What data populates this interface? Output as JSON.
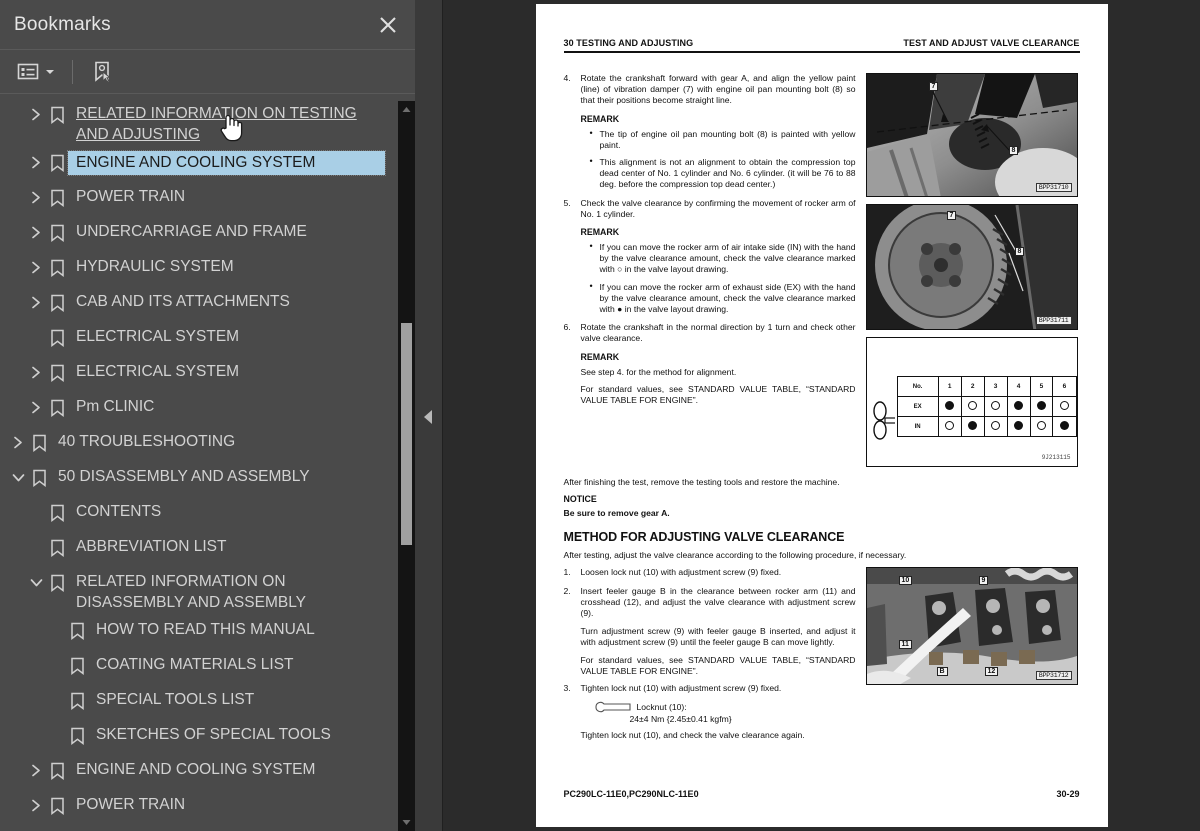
{
  "panel": {
    "title": "Bookmarks",
    "close_icon": "close-icon",
    "toolbar": {
      "options_icon": "list-options-icon",
      "dropdown_icon": "chevron-down-icon",
      "new_bookmark_icon": "new-bookmark-icon"
    },
    "items": [
      {
        "label": "RELATED INFORMATION ON TESTING AND ADJUSTING",
        "level": 1,
        "twisty": "collapsed",
        "state": "hovered"
      },
      {
        "label": "ENGINE AND COOLING SYSTEM",
        "level": 1,
        "twisty": "collapsed",
        "state": "selected"
      },
      {
        "label": "POWER TRAIN",
        "level": 1,
        "twisty": "collapsed",
        "state": "normal"
      },
      {
        "label": "UNDERCARRIAGE AND FRAME",
        "level": 1,
        "twisty": "collapsed",
        "state": "normal"
      },
      {
        "label": "HYDRAULIC SYSTEM",
        "level": 1,
        "twisty": "collapsed",
        "state": "normal"
      },
      {
        "label": "CAB AND ITS ATTACHMENTS",
        "level": 1,
        "twisty": "collapsed",
        "state": "normal"
      },
      {
        "label": "ELECTRICAL SYSTEM",
        "level": 1,
        "twisty": "none",
        "state": "normal"
      },
      {
        "label": "ELECTRICAL SYSTEM",
        "level": 1,
        "twisty": "collapsed",
        "state": "normal"
      },
      {
        "label": "Pm CLINIC",
        "level": 1,
        "twisty": "collapsed",
        "state": "normal"
      },
      {
        "label": "40 TROUBLESHOOTING",
        "level": 0,
        "twisty": "collapsed",
        "state": "normal"
      },
      {
        "label": "50 DISASSEMBLY AND ASSEMBLY",
        "level": 0,
        "twisty": "expanded",
        "state": "normal"
      },
      {
        "label": "CONTENTS",
        "level": 1,
        "twisty": "none",
        "state": "normal"
      },
      {
        "label": "ABBREVIATION LIST",
        "level": 1,
        "twisty": "none",
        "state": "normal"
      },
      {
        "label": "RELATED INFORMATION ON DISASSEMBLY AND ASSEMBLY",
        "level": 1,
        "twisty": "expanded",
        "state": "normal"
      },
      {
        "label": "HOW TO READ THIS MANUAL",
        "level": 2,
        "twisty": "none",
        "state": "normal"
      },
      {
        "label": "COATING MATERIALS LIST",
        "level": 2,
        "twisty": "none",
        "state": "normal"
      },
      {
        "label": "SPECIAL TOOLS LIST",
        "level": 2,
        "twisty": "none",
        "state": "normal"
      },
      {
        "label": "SKETCHES OF SPECIAL TOOLS",
        "level": 2,
        "twisty": "none",
        "state": "normal"
      },
      {
        "label": "ENGINE AND COOLING SYSTEM",
        "level": 1,
        "twisty": "collapsed",
        "state": "normal"
      },
      {
        "label": "POWER TRAIN",
        "level": 1,
        "twisty": "collapsed",
        "state": "normal"
      }
    ],
    "colors": {
      "panel_bg": "#4a4a4a",
      "selection": "#a9cfe6",
      "text": "#d2d2d2"
    }
  },
  "divider": {
    "collapse_icon": "collapse-left-triangle-icon"
  },
  "document": {
    "header_left": "30 TESTING AND ADJUSTING",
    "header_right": "TEST AND ADJUST VALVE CLEARANCE",
    "footer_left": "PC290LC-11E0,PC290NLC-11E0",
    "footer_right": "30-29",
    "step4_num": "4.",
    "step4_text": "Rotate the crankshaft forward with gear A, and align the yellow paint (line) of vibration damper (7) with engine oil pan mounting bolt (8) so that their positions become straight line.",
    "remark1_label": "REMARK",
    "remark1_bullets": [
      "The tip of engine oil pan mounting bolt (8) is painted with yellow paint.",
      "This alignment is not an alignment to obtain the compression top dead center of No. 1 cylinder and No. 6 cylinder. (it will be 76 to 88 deg. before the compression top dead center.)"
    ],
    "step5_num": "5.",
    "step5_text": "Check the valve clearance by confirming the movement of rocker arm of No. 1 cylinder.",
    "remark2_label": "REMARK",
    "remark2_bullets": [
      "If you can move the rocker arm of air intake side (IN) with the hand by the valve clearance amount, check the valve clearance marked with ○ in the valve layout drawing.",
      "If you can move the rocker arm of exhaust side (EX) with the hand by the valve clearance amount, check the valve clearance marked with ● in the valve layout drawing."
    ],
    "step6_num": "6.",
    "step6_text": "Rotate the crankshaft in the normal direction by 1 turn and check other valve clearance.",
    "remark3_label": "REMARK",
    "remark3_line1": "See step 4. for the method for alignment.",
    "remark3_line2": "For standard values, see STANDARD VALUE TABLE, “STANDARD VALUE TABLE FOR ENGINE”.",
    "after_test": "After finishing the test, remove the testing tools and restore the machine.",
    "notice_label": "NOTICE",
    "notice_text": "Be sure to remove gear A.",
    "method_heading": "METHOD FOR ADJUSTING VALVE CLEARANCE",
    "method_intro": "After testing, adjust the valve clearance according to the following procedure, if necessary.",
    "m1_num": "1.",
    "m1_text": "Loosen lock nut (10) with adjustment screw (9) fixed.",
    "m2_num": "2.",
    "m2_text": "Insert feeler gauge B in the clearance between rocker arm (11) and crosshead (12), and adjust the valve clearance with adjustment screw (9).",
    "m2_p2": "Turn adjustment screw (9) with feeler gauge B inserted, and adjust it with adjustment screw (9) until the feeler gauge B can move lightly.",
    "m2_p3": "For standard values, see STANDARD VALUE TABLE, “STANDARD VALUE TABLE FOR ENGINE”.",
    "m3_num": "3.",
    "m3_text": "Tighten lock nut (10) with adjustment screw (9) fixed.",
    "torque_label": "Locknut (10):",
    "torque_value": "24±4 Nm {2.45±0.41 kgfm}",
    "m3_p2": "Tighten lock nut (10), and check the valve clearance again.",
    "figures": [
      {
        "name": "vibration-damper-photo",
        "caption": "BPP31710",
        "callouts": [
          "7",
          "8"
        ]
      },
      {
        "name": "flywheel-photo",
        "caption": "BPP31711",
        "callouts": [
          "7",
          "8"
        ]
      },
      {
        "name": "rocker-arm-photo",
        "caption": "BPP31712",
        "callouts": [
          "9",
          "10",
          "11",
          "12",
          "B"
        ]
      }
    ],
    "valve_table": {
      "code": "9J213115",
      "row_header_no": "No.",
      "columns": [
        "1",
        "2",
        "3",
        "4",
        "5",
        "6"
      ],
      "rows": [
        {
          "label": "EX",
          "marks": [
            "fill",
            "open",
            "open",
            "fill",
            "fill",
            "open"
          ]
        },
        {
          "label": "IN",
          "marks": [
            "open",
            "fill",
            "open",
            "fill",
            "open",
            "fill"
          ]
        }
      ]
    }
  },
  "cursor": {
    "icon": "hand-pointer-cursor"
  }
}
